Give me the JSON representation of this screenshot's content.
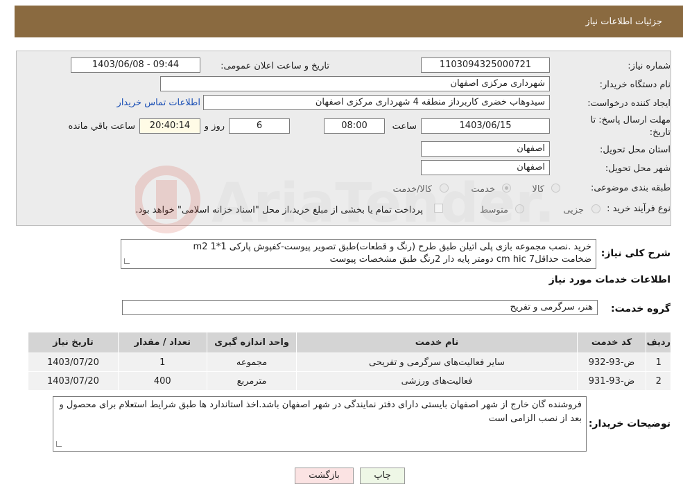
{
  "header": {
    "title": "جزئیات اطلاعات نیاز"
  },
  "form": {
    "need_number": {
      "label": "شماره نیاز:",
      "value": "1103094325000721"
    },
    "announce": {
      "label": "تاریخ و ساعت اعلان عمومی:",
      "value": "1403/06/08 - 09:44"
    },
    "buyer_org": {
      "label": "نام دستگاه خریدار:",
      "value": "شهرداری مرکزی اصفهان"
    },
    "creator": {
      "label": "ایجاد کننده درخواست:",
      "value": "سیدوهاب خضری کاربرداز منطقه 4 شهرداری مرکزی اصفهان",
      "contact_link": "اطلاعات تماس خریدار"
    },
    "deadline": {
      "label_line1": "مهلت ارسال پاسخ: تا",
      "label_line2": "تاریخ:",
      "date": "1403/06/15",
      "time_label": "ساعت",
      "time": "08:00",
      "days": "6",
      "days_label": "روز و",
      "remaining": "20:40:14",
      "remaining_label": "ساعت باقي مانده"
    },
    "province": {
      "label": "استان محل تحویل:",
      "value": "اصفهان"
    },
    "city": {
      "label": "شهر محل تحویل:",
      "value": "اصفهان"
    },
    "category": {
      "label": "طبقه بندی موضوعی:",
      "options": [
        "کالا",
        "خدمت",
        "کالا/خدمت"
      ]
    },
    "process": {
      "label": "نوع فرآیند خرید :",
      "options": [
        "جزیی",
        "متوسط"
      ],
      "note": "پرداخت تمام یا بخشی از مبلغ خرید،از محل \"اسناد خزانه اسلامی\" خواهد بود."
    }
  },
  "description": {
    "label": "شرح کلی نیاز:",
    "line1": "خرید .نصب مجموعه بازی پلی اتیلن طبق طرح (رنگ و قطعات)طبق تصویر پیوست-کفپوش پارکی m2 1*1",
    "line2": "ضخامت حداقل7 cm hic دومتر پایه دار 2رنگ طبق مشخصات پیوست"
  },
  "services": {
    "title": "اطلاعات خدمات مورد نیاز",
    "group_label": "گروه خدمت:",
    "group_value": "هنر، سرگرمی و تفریح",
    "columns": [
      "ردیف",
      "کد خدمت",
      "نام خدمت",
      "واحد اندازه گیری",
      "تعداد / مقدار",
      "تاریخ نیاز"
    ],
    "rows": [
      [
        "1",
        "ض-93-932",
        "سایر فعالیت‌های سرگرمی و تفریحی",
        "مجموعه",
        "1",
        "1403/07/20"
      ],
      [
        "2",
        "ض-93-931",
        "فعالیت‌های ورزشی",
        "مترمربع",
        "400",
        "1403/07/20"
      ]
    ]
  },
  "notes": {
    "label": "توضیحات خریدار:",
    "text": "فروشنده گان خارج از شهر اصفهان بایستی دارای دفتر نمایندگی در شهر اصفهان باشد.اخذ استاندارد ها طبق شرایط استعلام برای محصول و بعد از نصب الزامی است"
  },
  "buttons": {
    "print": "چاپ",
    "back": "بازگشت"
  },
  "watermark_text": "AriaTender.neT",
  "colors": {
    "header": "#8a6a40",
    "panel": "#ececec",
    "link": "#1a4fb5",
    "watermark": "#d34a3a"
  }
}
